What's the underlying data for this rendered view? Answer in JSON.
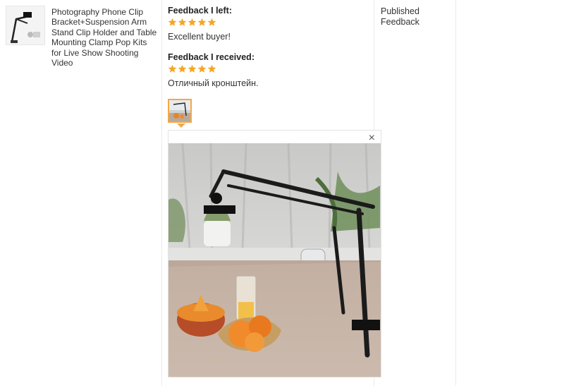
{
  "product": {
    "thumbnail_icon": "phone-clip-stand-image",
    "title": "Photography Phone Clip Bracket+Suspension Arm Stand Clip Holder and Table Mounting Clamp Pop Kits for Live Show Shooting Video"
  },
  "feedback_left": {
    "heading": "Feedback I left:",
    "rating": 5,
    "text": "Excellent buyer!"
  },
  "feedback_received": {
    "heading": "Feedback I received:",
    "rating": 5,
    "text": "Отличный кронштейн.",
    "photo_icon": "review-photo"
  },
  "viewer": {
    "close_label": "×"
  },
  "status": {
    "text": "Published Feedback"
  },
  "colors": {
    "star": "#f5a623",
    "accent_border": "#f3a847",
    "divider": "#ebebeb"
  }
}
